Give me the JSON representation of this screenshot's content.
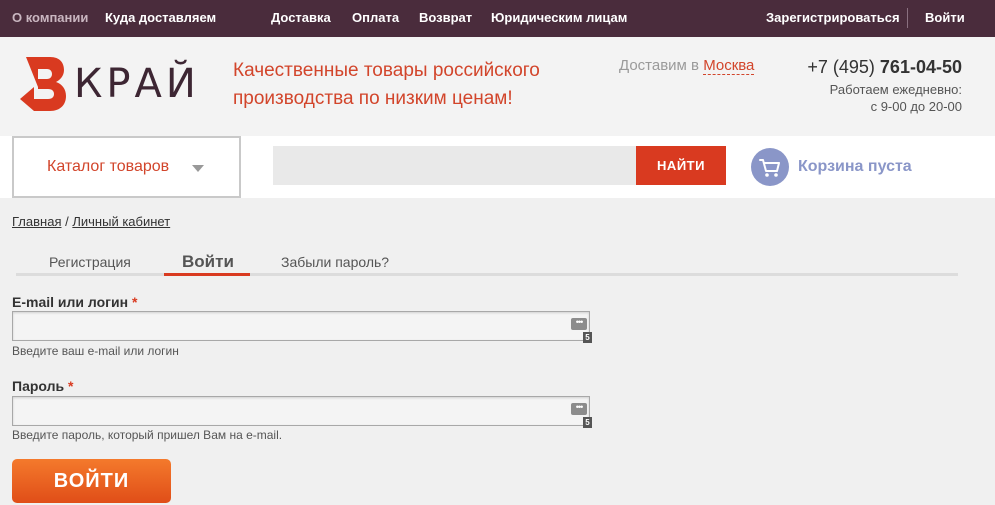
{
  "topnav": {
    "items": [
      "О компании",
      "Куда доставляем",
      "Доставка",
      "Оплата",
      "Возврат",
      "Юридическим лицам"
    ],
    "register": "Зарегистрироваться",
    "login": "Войти"
  },
  "header": {
    "logo_text": "КРАЙ",
    "slogan_line1": "Качественные товары российского",
    "slogan_line2": "производства по низким ценам!",
    "deliver_prefix": "Доставим в",
    "city": "Москва",
    "phone_prefix": "+7 (495)",
    "phone_number": "761-04-50",
    "hours_line1": "Работаем ежедневно:",
    "hours_line2": "с 9-00 до 20-00"
  },
  "nav": {
    "catalog_label": "Каталог товаров",
    "search_placeholder": "",
    "search_button": "НАЙТИ",
    "cart_label": "Корзина пуста"
  },
  "breadcrumb": {
    "home": "Главная",
    "separator": "/",
    "current": "Личный кабинет"
  },
  "tabs": {
    "register": "Регистрация",
    "login": "Войти",
    "forgot": "Забыли пароль?"
  },
  "form": {
    "login_label": "E-mail или логин",
    "login_value": "",
    "login_hint": "Введите ваш e-mail или логин",
    "password_label": "Пароль",
    "password_value": "",
    "password_hint": "Введите пароль, который пришел Вам на e-mail.",
    "required_mark": "*",
    "field_badge": "5",
    "submit": "ВОЙТИ"
  },
  "colors": {
    "topbar": "#4a2c3c",
    "accent": "#d93a20",
    "cart": "#8a96c8"
  }
}
